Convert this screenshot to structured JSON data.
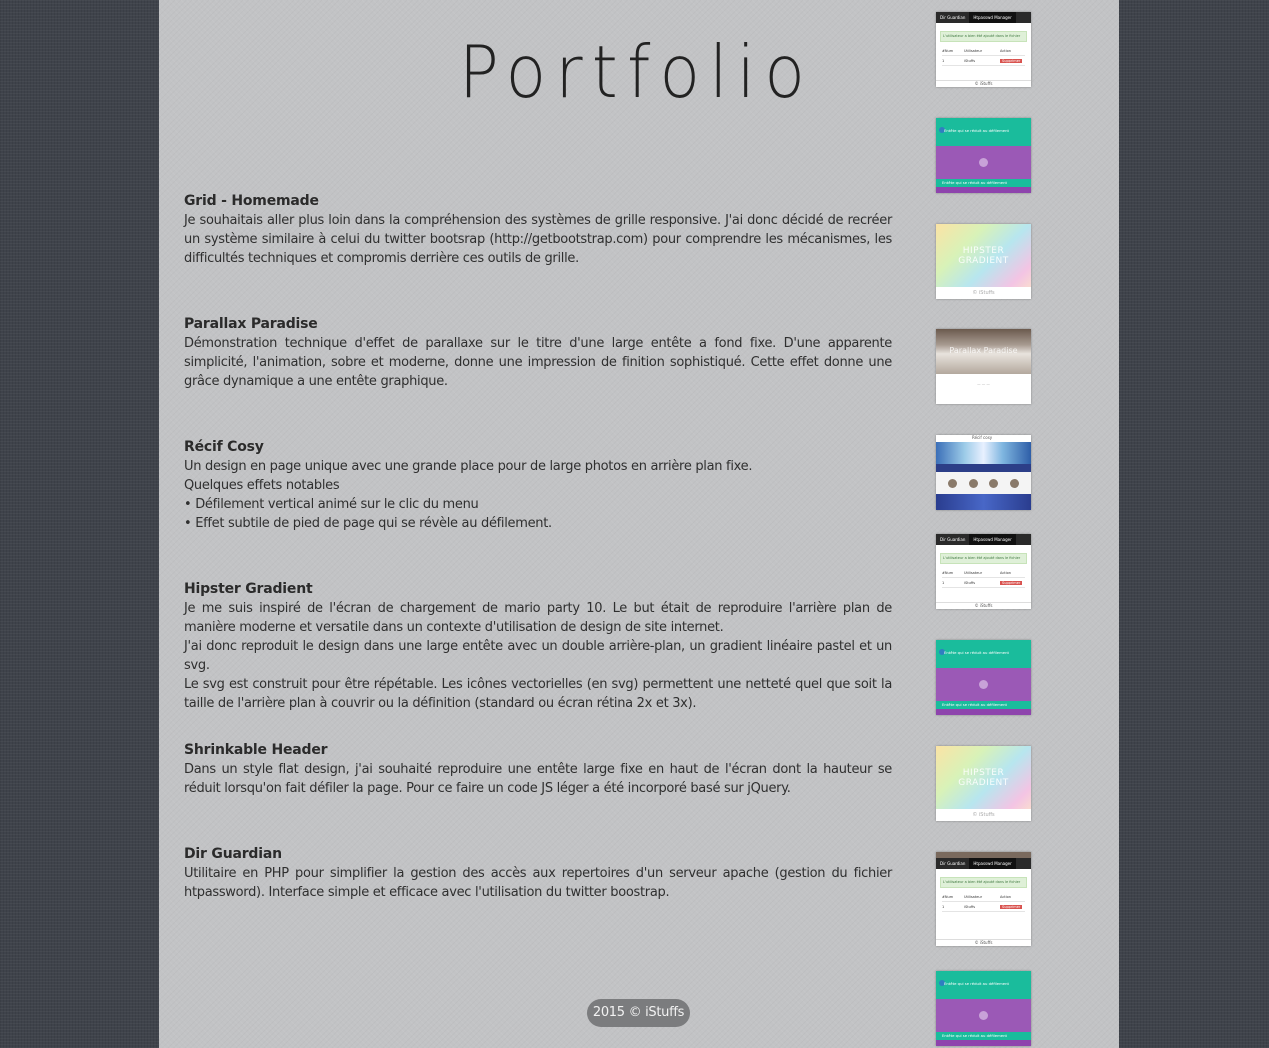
{
  "title": "Portfolio",
  "projects": [
    {
      "title": "Grid - Homemade",
      "lines": [
        "Je souhaitais aller plus loin dans la compréhension des systèmes de grille responsive. J'ai donc décidé de recréer un système similaire à celui du twitter bootsrap (http://getbootstrap.com) pour comprendre les mécanismes, les difficultés techniques et compromis derrière ces outils de grille."
      ]
    },
    {
      "title": "Parallax Paradise",
      "lines": [
        "Démonstration technique d'effet de parallaxe sur le titre d'une large entête a fond fixe. D'une apparente simplicité, l'animation, sobre et moderne, donne une impression de finition sophistiqué. Cette effet donne une grâce dynamique a une entête graphique."
      ]
    },
    {
      "title": "Récif Cosy",
      "lines": [
        "Un design en page unique avec une grande place pour de large photos en arrière plan fixe.",
        "Quelques effets notables",
        "• Défilement vertical animé sur le clic du menu",
        "• Effet subtile de pied de page qui se révèle au défilement."
      ]
    },
    {
      "title": "Hipster Gradient",
      "lines": [
        "Je me suis inspiré de l'écran de chargement de mario party 10. Le but était de reproduire l'arrière plan de manière moderne et versatile dans un contexte d'utilisation de design de site internet.",
        "J'ai donc reproduit le design dans une large entête avec un double arrière-plan, un gradient linéaire pastel et un svg.",
        "Le svg est construit pour être répétable. Les icônes vectorielles (en svg) permettent une netteté quel que soit la taille de l'arrière plan à couvrir ou la définition (standard ou écran rétina 2x et 3x)."
      ]
    },
    {
      "title": "Shrinkable Header",
      "lines": [
        "Dans un style flat design, j'ai souhaité reproduire une entête large fixe en haut de l'écran dont la hauteur se réduit lorsqu'on fait défiler la page. Pour ce faire un code JS léger a été incorporé basé sur jQuery."
      ]
    },
    {
      "title": "Dir Guardian",
      "lines": [
        "Utilitaire en PHP pour simplifier la gestion des accès aux repertoires d'un serveur apache (gestion du fichier htpassword). Interface simple et efficace avec l'utilisation du twitter boostrap."
      ]
    }
  ],
  "thumbs": {
    "dir": {
      "tab1": "Dir Guardian",
      "tab2": "Htpasswd Manager",
      "alert": "L'utilisateur a bien été ajouté dans le fichier",
      "col1": "#Num",
      "col2": "Utilisateur",
      "col3": "Action",
      "row_num": "1",
      "row_user": "iStuffs",
      "row_btn": "Supprimer",
      "foot": "© iStuffs"
    },
    "shrink": {
      "top_text": "Entête qui se réduit au défilement",
      "bot_text": "Entête qui se réduit au défilement"
    },
    "hipster": {
      "word": "HIPSTER GRADIENT",
      "foot": "© iStuffs"
    },
    "parallax": {
      "word": "Parallax Paradise"
    },
    "recif": {
      "hdr": "Récif cosy"
    }
  },
  "footer": "2015 © iStuffs"
}
